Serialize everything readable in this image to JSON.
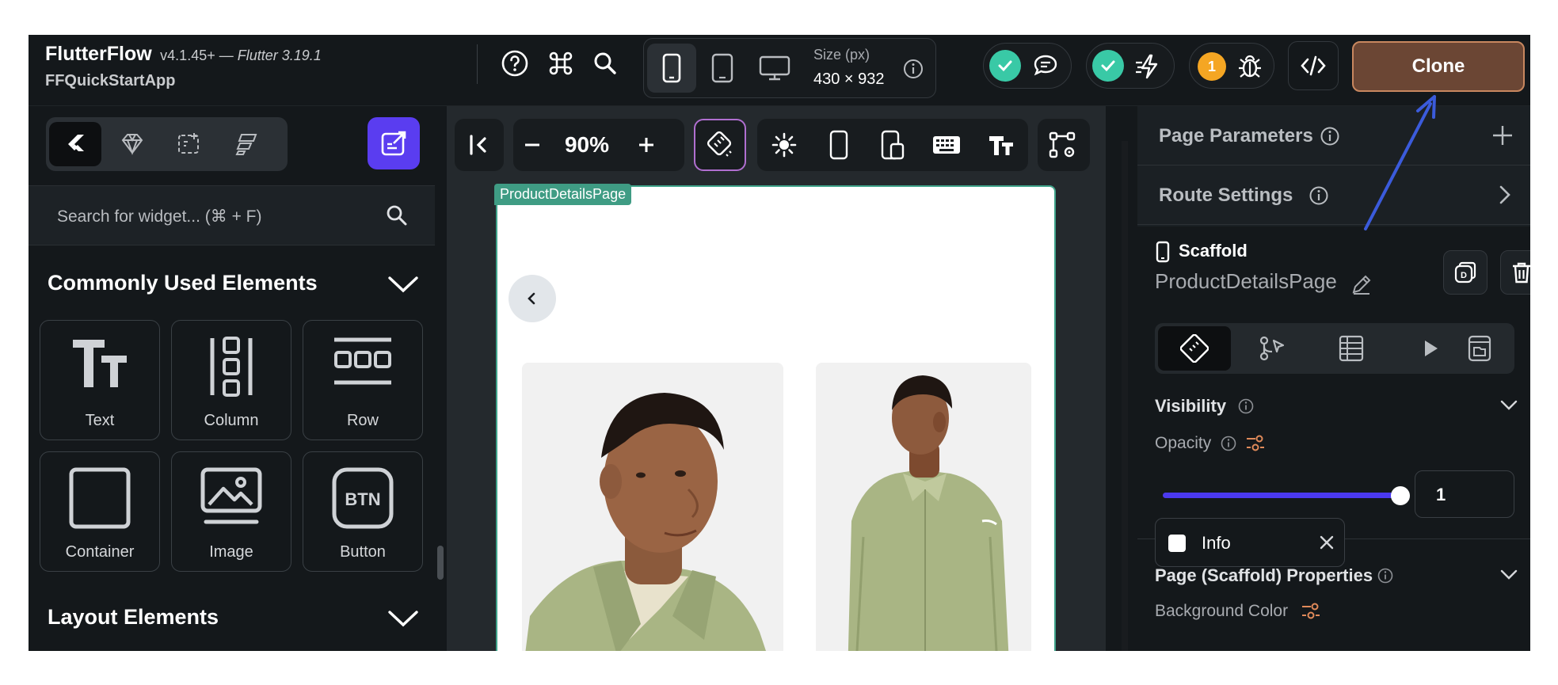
{
  "topbar": {
    "app_name": "FlutterFlow",
    "version": "v4.1.45+",
    "flutter_version": "— Flutter 3.19.1",
    "project_name": "FFQuickStartApp",
    "size_label": "Size (px)",
    "size_value": "430 × 932",
    "notification_count": "1",
    "clone_label": "Clone"
  },
  "left_panel": {
    "search_placeholder": "Search for widget... (⌘ + F)",
    "section_common": "Commonly Used Elements",
    "section_layout": "Layout Elements",
    "widgets": [
      {
        "label": "Text",
        "icon": "text-icon"
      },
      {
        "label": "Column",
        "icon": "column-icon"
      },
      {
        "label": "Row",
        "icon": "row-icon"
      },
      {
        "label": "Container",
        "icon": "container-icon"
      },
      {
        "label": "Image",
        "icon": "image-icon"
      },
      {
        "label": "Button",
        "icon": "button-icon",
        "glyph": "BTN"
      }
    ]
  },
  "canvas": {
    "zoom": "90%",
    "page_name": "ProductDetailsPage"
  },
  "right_panel": {
    "page_parameters": "Page Parameters",
    "route_settings": "Route Settings",
    "widget_type": "Scaffold",
    "widget_name": "ProductDetailsPage",
    "visibility": "Visibility",
    "opacity_label": "Opacity",
    "opacity_value": "1",
    "page_properties": "Page (Scaffold) Properties",
    "background_color_label": "Background Color",
    "background_color_value": "Info"
  },
  "colors": {
    "accent": "#4B39EF",
    "clone_bg": "#6B4634",
    "success": "#39C9A6",
    "warning": "#F5A623",
    "page_tag": "#3F9C84"
  }
}
